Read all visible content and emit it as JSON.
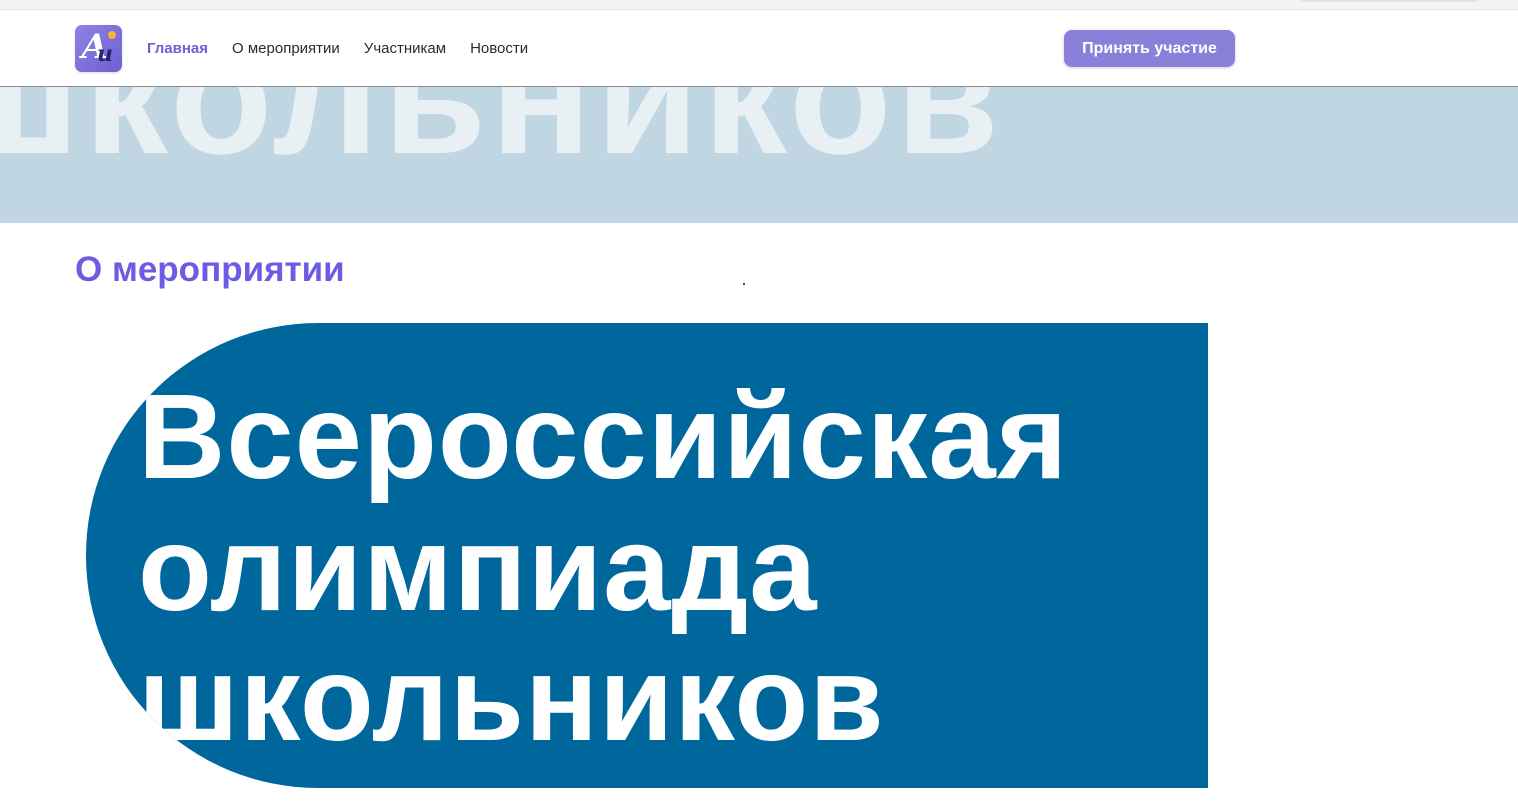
{
  "header": {
    "logo_letters": "Аи",
    "nav": [
      {
        "label": "Главная",
        "active": true
      },
      {
        "label": "О мероприятии",
        "active": false
      },
      {
        "label": "Участникам",
        "active": false
      },
      {
        "label": "Новости",
        "active": false
      }
    ],
    "cta_label": "Принять участие"
  },
  "hero": {
    "watermark_text": "школьников"
  },
  "section": {
    "title": "О мероприятии"
  },
  "banner": {
    "line1": "Всероссийская",
    "line2": "олимпиада",
    "line3": "школьников"
  },
  "colors": {
    "accent": "#6b5ce3",
    "cta_bg": "#8a7fd9",
    "hero_band": "#c0d6e2",
    "banner_bg": "#00679d"
  }
}
